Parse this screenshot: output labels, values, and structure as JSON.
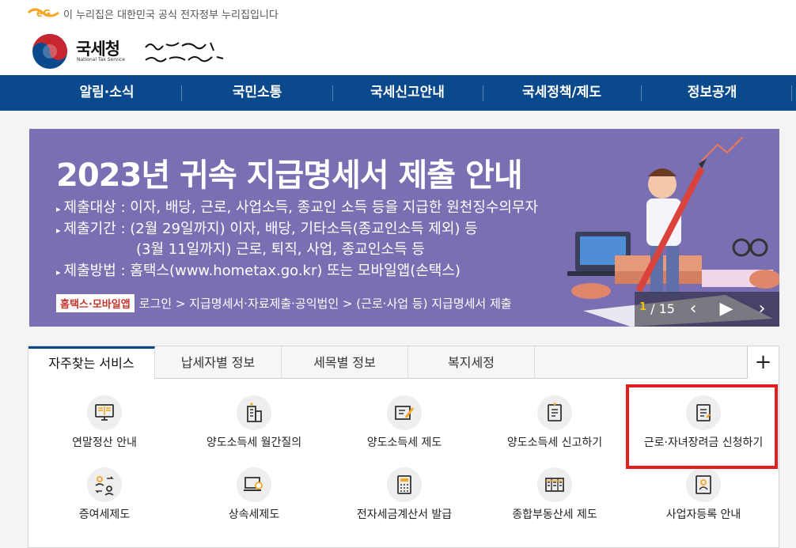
{
  "gov_notice": "이 누리집은 대한민국 공식 전자정부 누리집입니다",
  "logo": {
    "name_ko": "국세청",
    "name_en": "National Tax Service"
  },
  "nav": [
    "알림·소식",
    "국민소통",
    "국세신고안내",
    "국세정책/제도",
    "정보공개"
  ],
  "banner": {
    "title": "2023년 귀속 지급명세서 제출 안내",
    "lines": [
      "제출대상 : 이자, 배당, 근로, 사업소득, 종교인 소득 등을 지급한 원천징수의무자",
      "제출기간 : (2월 29일까지) 이자, 배당, 기타소득(종교인소득 제외) 등",
      "(3월 11일까지) 근로, 퇴직, 사업, 종교인소득 등",
      "제출방법 : 홈택스(www.hometax.go.kr) 또는 모바일앱(손택스)"
    ],
    "tag": "홈택스·모바일앱",
    "path": "로그인 > 지급명세서·자료제출·공익법인 > (근로·사업 등) 지급명세서 제출",
    "page_current": "1",
    "page_total": "/ 15"
  },
  "tabs": [
    "자주찾는 서비스",
    "납세자별 정보",
    "세목별 정보",
    "복지세정"
  ],
  "plus_label": "+",
  "services": [
    "연말정산 안내",
    "양도소득세 월간질의",
    "양도소득세 제도",
    "양도소득세 신고하기",
    "근로·자녀장려금 신청하기",
    "증여세제도",
    "상속세제도",
    "전자세금계산서 발급",
    "종합부동산세 제도",
    "사업자등록 안내"
  ],
  "colors": {
    "nav": "#0a4a8c",
    "banner": "#7b6fb3",
    "highlight": "#e41e1e",
    "icon_accent": "#f5a623"
  }
}
